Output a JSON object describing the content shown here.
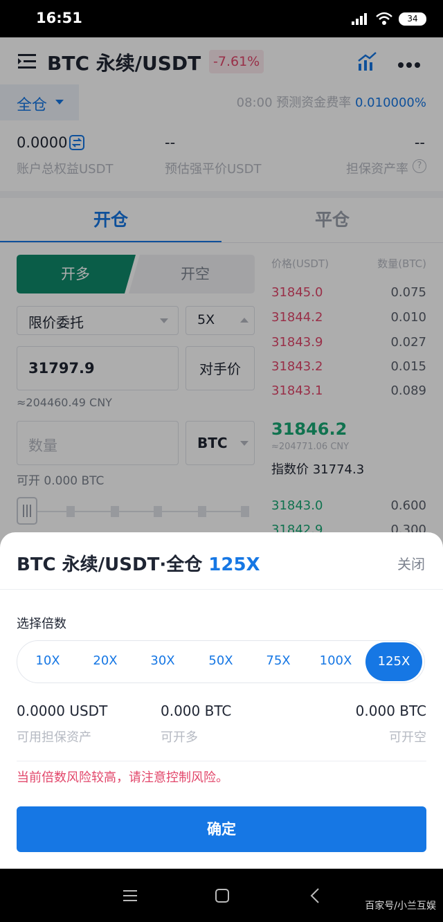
{
  "status": {
    "time": "16:51",
    "battery": "34"
  },
  "header": {
    "title": "BTC 永续/USDT",
    "change": "-7.61%"
  },
  "mode": {
    "margin": "全仓",
    "funding_label": "08:00 预测资金费率",
    "funding_value": "0.010000%"
  },
  "account": {
    "equity_value": "0.0000",
    "equity_label": "账户总权益USDT",
    "liq_value": "--",
    "liq_label": "预估强平价USDT",
    "ratio_value": "--",
    "ratio_label": "担保资产率"
  },
  "tabs": {
    "open": "开仓",
    "close": "平仓"
  },
  "order": {
    "long": "开多",
    "short": "开空",
    "type": "限价委托",
    "leverage": "5X",
    "price": "31797.9",
    "counter": "对手价",
    "cny": "≈204460.49 CNY",
    "qty_placeholder": "数量",
    "unit": "BTC",
    "available": "可开 0.000 BTC"
  },
  "orderbook": {
    "price_header": "价格(USDT)",
    "qty_header": "数量(BTC)",
    "asks": [
      {
        "price": "31845.0",
        "qty": "0.075"
      },
      {
        "price": "31844.2",
        "qty": "0.010"
      },
      {
        "price": "31843.9",
        "qty": "0.027"
      },
      {
        "price": "31843.2",
        "qty": "0.015"
      },
      {
        "price": "31843.1",
        "qty": "0.089"
      }
    ],
    "last": "31846.2",
    "last_cny": "≈204771.06 CNY",
    "index": "指数价 31774.3",
    "bids": [
      {
        "price": "31843.0",
        "qty": "0.600"
      },
      {
        "price": "31842.9",
        "qty": "0.300"
      }
    ]
  },
  "sheet": {
    "title": "BTC 永续/USDT·全仓",
    "title_leverage": "125X",
    "close": "关闭",
    "select_label": "选择倍数",
    "leverages": [
      "10X",
      "20X",
      "30X",
      "50X",
      "75X",
      "100X",
      "125X"
    ],
    "selected": "125X",
    "avail_value": "0.0000 USDT",
    "avail_label": "可用担保资产",
    "long_value": "0.000 BTC",
    "long_label": "可开多",
    "short_value": "0.000 BTC",
    "short_label": "可开空",
    "warning": "当前倍数风险较高，请注意控制风险。",
    "confirm": "确定"
  },
  "watermark": "百家号/小兰互娱",
  "colors": {
    "accent": "#1677e4",
    "long_green": "#0f8a6a",
    "down_red": "#e2466a",
    "warning": "#e2466a"
  }
}
